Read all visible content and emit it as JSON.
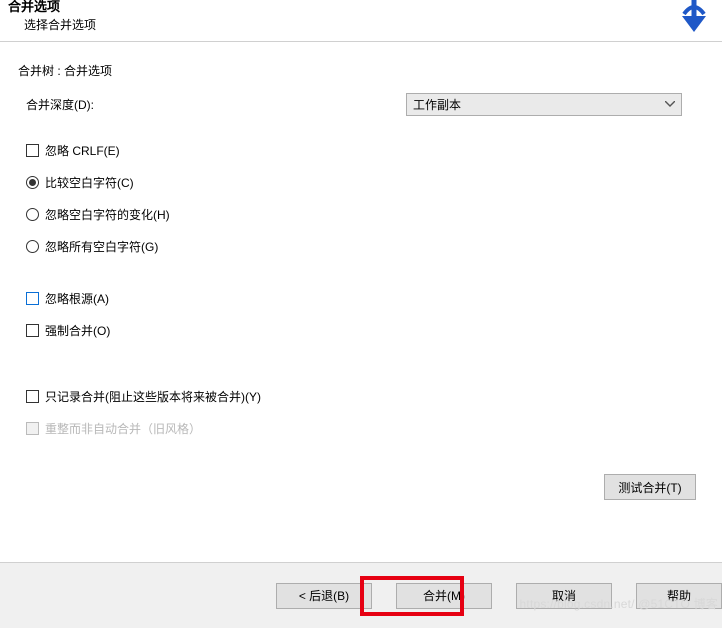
{
  "header": {
    "title_truncated": "合并选项",
    "subtitle": "选择合并选项"
  },
  "group": {
    "title": "合并树 : 合并选项",
    "depth_label": "合并深度(D):",
    "depth_value": "工作副本"
  },
  "checks": {
    "ignore_crlf": "忽略 CRLF(E)"
  },
  "radios": {
    "compare_ws": "比较空白字符(C)",
    "ignore_ws_change": "忽略空白字符的变化(H)",
    "ignore_all_ws": "忽略所有空白字符(G)"
  },
  "checks2": {
    "ignore_origin": "忽略根源(A)",
    "force_merge": "强制合并(O)"
  },
  "checks3": {
    "record_only": "只记录合并(阻止这些版本将来被合并)(Y)",
    "reintegrate": "重整而非自动合并（旧风格）"
  },
  "buttons": {
    "test_merge": "测试合并(T)",
    "back": "< 后退(B)",
    "merge": "合并(M)",
    "cancel": "取消",
    "help": "帮助"
  },
  "watermark": "https://blog.csdn.net/  @51CTO 博客"
}
